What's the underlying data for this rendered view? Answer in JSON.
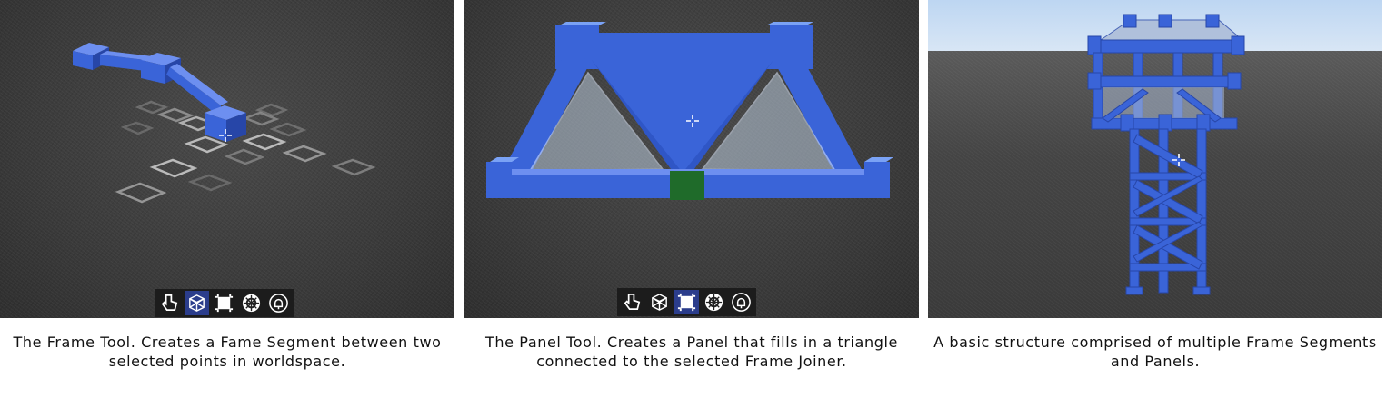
{
  "panels": [
    {
      "caption": "The Frame Tool. Creates a Fame Segment between two selected points in worldspace.",
      "toolbar": {
        "active_tool": "frame-tool",
        "tools": [
          "select-tool",
          "frame-tool",
          "panel-tool",
          "joiner-tool",
          "connector-tool"
        ]
      }
    },
    {
      "caption": "The Panel Tool. Creates a Panel that fills in a triangle connected to the selected Frame Joiner.",
      "toolbar": {
        "active_tool": "panel-tool",
        "tools": [
          "select-tool",
          "frame-tool",
          "panel-tool",
          "joiner-tool",
          "connector-tool"
        ]
      }
    },
    {
      "caption": "A basic structure comprised of multiple Frame Segments and Panels."
    }
  ],
  "colors": {
    "frame_blue": "#3a64d8",
    "frame_blue_dark": "#2746a8",
    "joiner_green": "#1f6b2a",
    "toolbar_bg": "#1c1c1c",
    "active_tool_bg": "#2b3d8c"
  }
}
